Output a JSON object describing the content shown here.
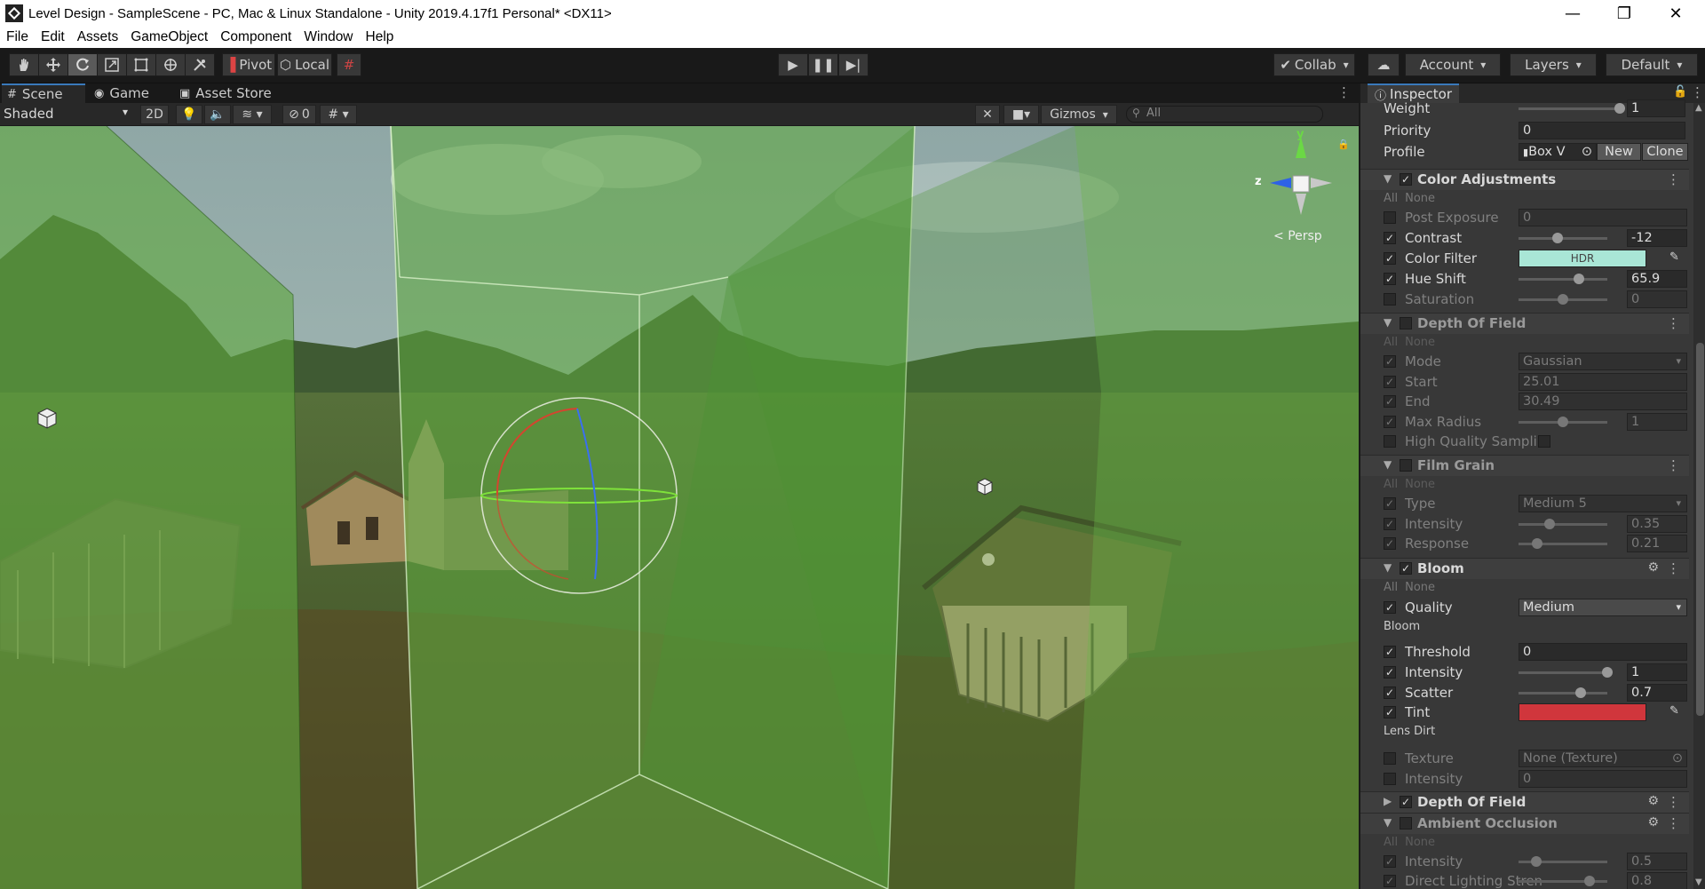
{
  "window": {
    "title": "Level Design - SampleScene - PC, Mac & Linux Standalone - Unity 2019.4.17f1 Personal* <DX11>",
    "controls": [
      "—",
      "❐",
      "✕"
    ]
  },
  "menu": [
    "File",
    "Edit",
    "Assets",
    "GameObject",
    "Component",
    "Window",
    "Help"
  ],
  "toolbar": {
    "pivot_label": "Pivot",
    "local_label": "Local",
    "collab_label": "Collab",
    "account_label": "Account",
    "layers_label": "Layers",
    "layout_label": "Default"
  },
  "tabs": [
    "Scene",
    "Game",
    "Asset Store"
  ],
  "scene_toolbar": {
    "shading_mode": "Shaded",
    "mode_2d": "2D",
    "hidden_count": "0",
    "gizmos_label": "Gizmos",
    "search_placeholder": "All"
  },
  "gizmo": {
    "y": "y",
    "z": "z",
    "persp": "Persp"
  },
  "inspector": {
    "tab_label": "Inspector",
    "weight": {
      "label": "Weight",
      "value": "1",
      "level": 1.0
    },
    "priority": {
      "label": "Priority",
      "value": "0"
    },
    "profile": {
      "label": "Profile",
      "value": "Box V",
      "new_label": "New",
      "clone_label": "Clone"
    },
    "all_label": "All",
    "none_label": "None",
    "color_adjustments": {
      "title": "Color Adjustments",
      "post_exposure": {
        "label": "Post Exposure",
        "value": "0"
      },
      "contrast": {
        "label": "Contrast",
        "value": "-12",
        "level": 0.44
      },
      "color_filter": {
        "label": "Color Filter",
        "value": "HDR",
        "color": "#a9e6d6"
      },
      "hue_shift": {
        "label": "Hue Shift",
        "value": "65.9",
        "level": 0.68
      },
      "saturation": {
        "label": "Saturation",
        "value": "0",
        "level": 0.5
      }
    },
    "depth_of_field": {
      "title": "Depth Of Field",
      "mode": {
        "label": "Mode",
        "value": "Gaussian"
      },
      "start": {
        "label": "Start",
        "value": "25.01"
      },
      "end": {
        "label": "End",
        "value": "30.49"
      },
      "max_radius": {
        "label": "Max Radius",
        "value": "1",
        "level": 0.5
      },
      "high_quality": {
        "label": "High Quality Samplin"
      }
    },
    "film_grain": {
      "title": "Film Grain",
      "type": {
        "label": "Type",
        "value": "Medium 5"
      },
      "intensity": {
        "label": "Intensity",
        "value": "0.35",
        "level": 0.35
      },
      "response": {
        "label": "Response",
        "value": "0.21",
        "level": 0.21
      }
    },
    "bloom": {
      "title": "Bloom",
      "quality": {
        "label": "Quality",
        "value": "Medium"
      },
      "section_bloom": "Bloom",
      "threshold": {
        "label": "Threshold",
        "value": "0"
      },
      "intensity": {
        "label": "Intensity",
        "value": "1",
        "level": 1.0
      },
      "scatter": {
        "label": "Scatter",
        "value": "0.7",
        "level": 0.7
      },
      "tint": {
        "label": "Tint",
        "color": "#d0363c"
      },
      "section_lens_dirt": "Lens Dirt",
      "texture": {
        "label": "Texture",
        "value": "None (Texture)"
      },
      "dirt_intensity": {
        "label": "Intensity",
        "value": "0"
      }
    },
    "depth_of_field_2": {
      "title": "Depth Of Field"
    },
    "ambient_occlusion": {
      "title": "Ambient Occlusion",
      "intensity": {
        "label": "Intensity",
        "value": "0.5",
        "level": 0.2
      },
      "direct_lighting": {
        "label": "Direct Lighting Stren",
        "value": "0.8",
        "level": 0.8
      }
    }
  },
  "colors": {
    "accent": "#3a79bb",
    "volume_green": "#5fa83f",
    "tint": "#d0363c",
    "color_filter": "#a9e6d6"
  }
}
